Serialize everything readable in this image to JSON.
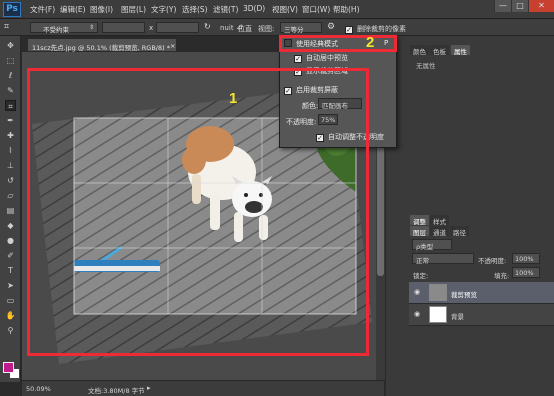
{
  "app": {
    "logo": "Ps"
  },
  "menu": [
    "文件(F)",
    "编辑(E)",
    "图像(I)",
    "图层(L)",
    "文字(Y)",
    "选择(S)",
    "滤镜(T)",
    "3D(D)",
    "视图(V)",
    "窗口(W)",
    "帮助(H)"
  ],
  "window_controls": {
    "minimize": "—",
    "maximize": "□",
    "close": "✕"
  },
  "options_bar": {
    "ratio": "不受约束",
    "swap": "x",
    "clear_label": "nuit",
    "straighten_label": "拉直",
    "view_label": "视图:",
    "view_value": "三等分",
    "delete_cropped_label": "删除裁剪的像素"
  },
  "document": {
    "tab_title": "11scz先点.jpg @ 50.1% (裁剪预览, RGB/8) *",
    "tab_close": "×",
    "zoom": "50.09%",
    "doc_info": "文档:3.80M/8 字节"
  },
  "dropdown": {
    "classic_mode": "使用经典模式",
    "classic_shortcut": "P",
    "auto_center": "自动居中预览",
    "show_cropped": "显示裁剪区域",
    "enable_shield": "启用裁剪屏蔽",
    "color_label": "颜色:",
    "color_value": "匹配画布",
    "opacity_label": "不透明度:",
    "opacity_value": "75%",
    "auto_adjust": "自动调整不透明度"
  },
  "annotations": {
    "one": "1",
    "two": "2"
  },
  "right_panel": {
    "tabs_top": [
      "颜色",
      "色板",
      "属性"
    ],
    "properties_text": "无属性",
    "tabs_mid": [
      "调整",
      "样式"
    ],
    "layer_tabs": [
      "图层",
      "通道",
      "路径"
    ],
    "filter_kind": "ρ类型",
    "blend_mode": "正常",
    "opacity_label": "不透明度:",
    "opacity_value": "100%",
    "lock_label": "锁定:",
    "fill_label": "填充:",
    "fill_value": "100%",
    "layers": [
      "裁剪预览",
      "背景"
    ]
  },
  "colors": {
    "foreground": "#c01c8c",
    "background": "#ffffff",
    "accent_red": "#ee2a36",
    "annot_yellow": "#f5e431"
  },
  "icons": [
    "move-icon",
    "marquee-icon",
    "lasso-icon",
    "quick-select-icon",
    "crop-icon",
    "eyedropper-icon",
    "healing-icon",
    "brush-icon",
    "clone-stamp-icon",
    "history-brush-icon",
    "eraser-icon",
    "gradient-icon",
    "blur-icon",
    "dodge-icon",
    "pen-icon",
    "type-icon",
    "path-select-icon",
    "shape-icon",
    "hand-icon",
    "zoom-icon"
  ]
}
